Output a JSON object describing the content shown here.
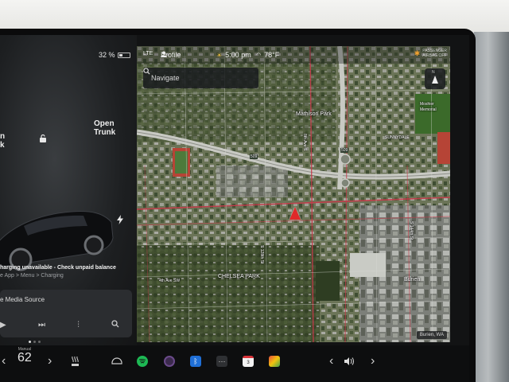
{
  "vehicle": {
    "battery_percent": "32 %",
    "open_trunk_top": "Open",
    "open_trunk_bottom": "Trunk",
    "frunk_partial_top": "n",
    "frunk_partial_bottom": "k",
    "charging_message": "harging unavailable - Check unpaid balance",
    "charging_path": "e App > Menu > Charging"
  },
  "media": {
    "source_label": "e Media Source"
  },
  "status": {
    "lte_label": "LTE",
    "profile_label": "Profile",
    "time": "5:00 pm",
    "temperature": "78°F",
    "airbag_line1": "PASSENGER",
    "airbag_line2": "AIRBAG OFF"
  },
  "map": {
    "search_placeholder": "Navigate",
    "compass_label": "N",
    "location_chip": "Burien, WA",
    "labels": {
      "mathison_park": "Mathison Park",
      "sunnydale": "SUNNYDALE",
      "moshier": "Moshier Memorial",
      "chelsea_park": "CHELSEA PARK",
      "burien": "Burien",
      "ave_8th": "8th Ave S",
      "ave_4th": "4th Ave SW",
      "st_s_128": "S 128th St",
      "st_s_144": "S 144th St",
      "hwy_509": "509",
      "hwy_509b": "509"
    }
  },
  "dock": {
    "speed_mode": "Manual",
    "speed_value": "62",
    "calendar_day": "3"
  },
  "colors": {
    "accent_red": "#e02a2a",
    "spotify_green": "#1db954",
    "bluetooth_blue": "#1f6fd6"
  }
}
